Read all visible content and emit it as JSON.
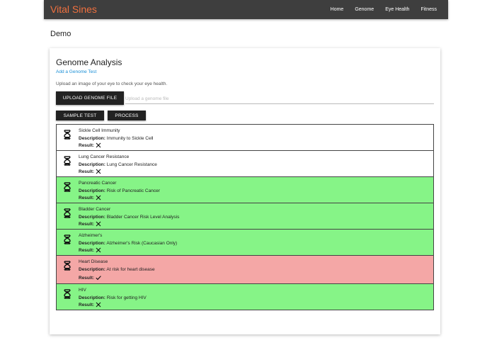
{
  "navbar": {
    "brand": "Vital Sines",
    "links": [
      "Home",
      "Genome",
      "Eye Health",
      "Fitness"
    ]
  },
  "page_title": "Demo",
  "card": {
    "title": "Genome Analysis",
    "add_link": "Add a Genome Test",
    "instructions": "Upload an image of your eye to check your eye health.",
    "upload_button": "UPLOAD GENOME FILE",
    "file_placeholder": "Upload a genome file",
    "sample_button": "SAMPLE TEST",
    "process_button": "PROCESS",
    "description_label": "Description:",
    "result_label": "Result:"
  },
  "results": [
    {
      "name": "Sickle Cell Immunity",
      "description": "Immunity to Sickle Cell",
      "result": "cross",
      "status": "white"
    },
    {
      "name": "Lung Cancer Resistance",
      "description": "Lung Cancer Resistance",
      "result": "cross",
      "status": "white"
    },
    {
      "name": "Pancreatic Cancer",
      "description": "Risk of Pancreatic Cancer",
      "result": "cross",
      "status": "green"
    },
    {
      "name": "Bladder Cancer",
      "description": "Bladder Cancer Risk Level Analysis",
      "result": "cross",
      "status": "green"
    },
    {
      "name": "Alzheimer's",
      "description": "Alzheimer's Risk (Caucasian Only)",
      "result": "cross",
      "status": "green"
    },
    {
      "name": "Heart Disease",
      "description": "At risk for heart disease",
      "result": "check",
      "status": "red"
    },
    {
      "name": "HIV",
      "description": "Risk for getting HIV",
      "result": "cross",
      "status": "green"
    }
  ],
  "colors": {
    "navbar_bg": "#3e3e3e",
    "brand": "#f0703e",
    "link": "#1a8fd6",
    "negative_row": "#86f487",
    "positive_row": "#f4a7a6",
    "button_bg": "#222222"
  },
  "icons": {
    "row_icon": "dna-icon",
    "result_negative": "close-icon",
    "result_positive": "check-icon"
  }
}
